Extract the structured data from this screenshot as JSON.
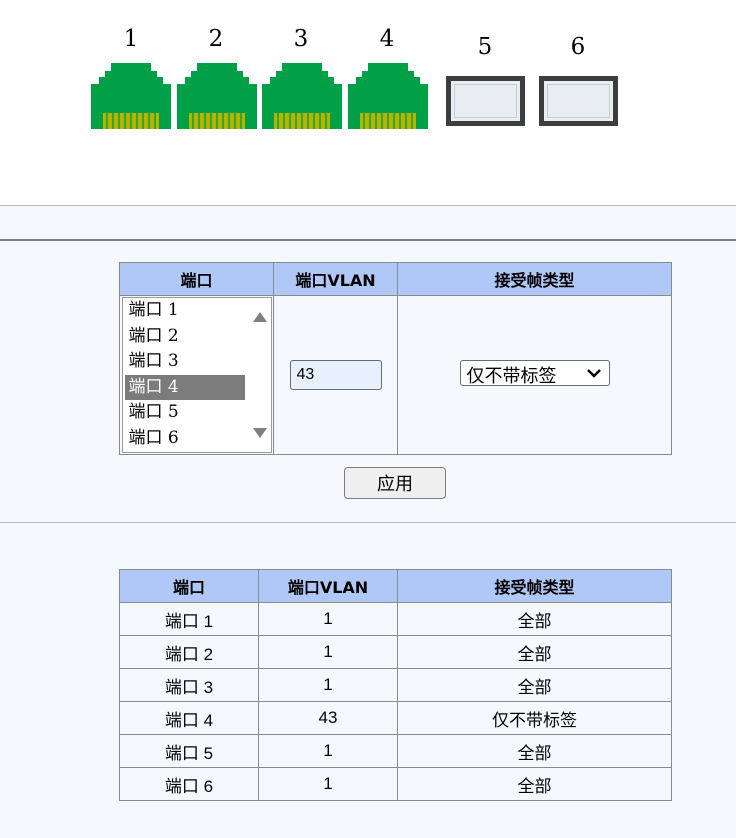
{
  "ports": [
    {
      "num": "1",
      "type": "rj45"
    },
    {
      "num": "2",
      "type": "rj45"
    },
    {
      "num": "3",
      "type": "rj45"
    },
    {
      "num": "4",
      "type": "rj45"
    },
    {
      "num": "5",
      "type": "sfp"
    },
    {
      "num": "6",
      "type": "sfp"
    }
  ],
  "colors": {
    "rj45_green": "#00a047",
    "rj45_pins": "#b5b500",
    "header_blue": "#b0c8f8",
    "background": "#f5f8fd",
    "selected_option": "#7b7b7b"
  },
  "config": {
    "headers": [
      "端口",
      "端口VLAN",
      "接受帧类型"
    ],
    "port_options": [
      "端口 1",
      "端口 2",
      "端口 3",
      "端口 4",
      "端口 5",
      "端口 6"
    ],
    "selected_port": "端口 4",
    "vlan_value": "43",
    "frame_type_selected": "仅不带标签",
    "apply_label": "应用"
  },
  "summary": {
    "headers": [
      "端口",
      "端口VLAN",
      "接受帧类型"
    ],
    "rows": [
      {
        "port": "端口 1",
        "vlan": "1",
        "frame": "全部"
      },
      {
        "port": "端口 2",
        "vlan": "1",
        "frame": "全部"
      },
      {
        "port": "端口 3",
        "vlan": "1",
        "frame": "全部"
      },
      {
        "port": "端口 4",
        "vlan": "43",
        "frame": "仅不带标签"
      },
      {
        "port": "端口 5",
        "vlan": "1",
        "frame": "全部"
      },
      {
        "port": "端口 6",
        "vlan": "1",
        "frame": "全部"
      }
    ]
  }
}
